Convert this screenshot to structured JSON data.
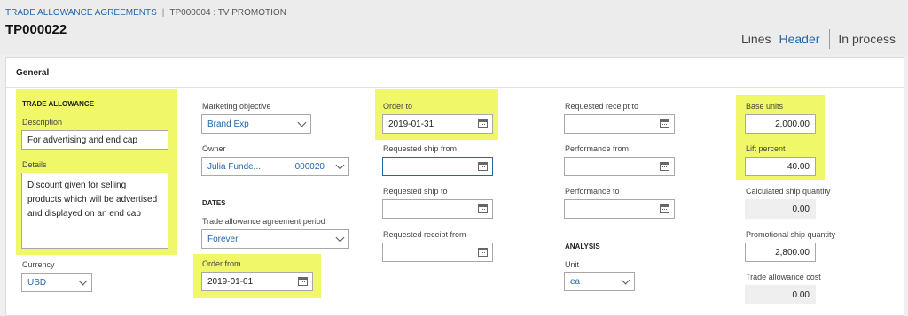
{
  "breadcrumb": {
    "root": "TRADE ALLOWANCE AGREEMENTS",
    "current": "TP000004 : TV PROMOTION"
  },
  "record_id": "TP000022",
  "view_tabs": {
    "lines": "Lines",
    "header": "Header",
    "status": "In process"
  },
  "panel": {
    "title": "General"
  },
  "trade_allowance": {
    "section": "TRADE ALLOWANCE",
    "description_label": "Description",
    "description_value": "For advertising and end cap",
    "details_label": "Details",
    "details_value": "Discount given for selling products which will be advertised and displayed on an end cap",
    "currency_label": "Currency",
    "currency_value": "USD"
  },
  "marketing": {
    "objective_label": "Marketing objective",
    "objective_value": "Brand Exp",
    "owner_label": "Owner",
    "owner_name": "Julia Funde...",
    "owner_number": "000020",
    "dates_section": "DATES",
    "period_label": "Trade allowance agreement period",
    "period_value": "Forever",
    "order_from_label": "Order from",
    "order_from_value": "2019-01-01"
  },
  "dates": {
    "order_to_label": "Order to",
    "order_to_value": "2019-01-31",
    "req_ship_from_label": "Requested ship from",
    "req_ship_from_value": "",
    "req_ship_to_label": "Requested ship to",
    "req_ship_to_value": "",
    "req_receipt_from_label": "Requested receipt from",
    "req_receipt_from_value": ""
  },
  "receipt": {
    "req_receipt_to_label": "Requested receipt to",
    "req_receipt_to_value": "",
    "perf_from_label": "Performance from",
    "perf_from_value": "",
    "perf_to_label": "Performance to",
    "perf_to_value": "",
    "analysis_section": "ANALYSIS",
    "unit_label": "Unit",
    "unit_value": "ea"
  },
  "quantities": {
    "base_units_label": "Base units",
    "base_units_value": "2,000.00",
    "lift_label": "Lift percent",
    "lift_value": "40.00",
    "calc_ship_label": "Calculated ship quantity",
    "calc_ship_value": "0.00",
    "promo_ship_label": "Promotional ship quantity",
    "promo_ship_value": "2,800.00",
    "cost_label": "Trade allowance cost",
    "cost_value": "0.00"
  },
  "colors": {
    "highlight": "#f0f869",
    "link": "#2266aa"
  }
}
